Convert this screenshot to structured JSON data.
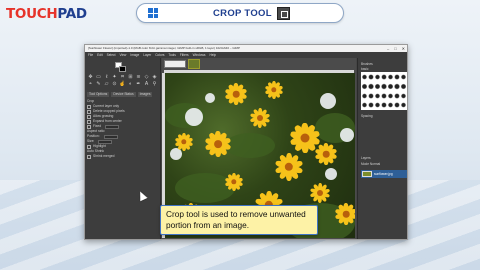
{
  "brand": {
    "part1": "TOUCH",
    "part2": "PAD"
  },
  "header": {
    "title": "CROP TOOL",
    "left_icon": "windows-icon",
    "right_icon": "crop-tool-icon"
  },
  "gimp": {
    "title": "[Sunflower Flower] (imported)-1.0 (RGB color 8-bit gamma integer, GIMP built-in sRGB, 1 layer) 1024x640 – GIMP",
    "menu": [
      "File",
      "Edit",
      "Select",
      "View",
      "Image",
      "Layer",
      "Colors",
      "Tools",
      "Filters",
      "Windows",
      "Help"
    ],
    "tool_options": {
      "tabs": [
        "Tool Options",
        "Device Status",
        "Images"
      ],
      "heading": "Crop",
      "current_layer_only": "Current layer only",
      "delete_pixels": "Delete cropped pixels",
      "allow_growing": "Allow growing",
      "expand_from_center": "Expand from center",
      "fixed": "Fixed",
      "aspect_ratio": "Aspect ratio",
      "highlight": "Highlight",
      "position": "Position:",
      "size": "Size:",
      "shrink": "Auto Shrink",
      "shrink_merged": "Shrink merged"
    },
    "dock": {
      "brushes_label": "Brushes",
      "brush_filter": "basic",
      "spacing_label": "Spacing",
      "layers_label": "Layers",
      "mode_label": "Mode Normal",
      "layer_name": "sunflower.jpg"
    },
    "photo_colors": {
      "petal": "#f6c21a",
      "center": "#b8600c",
      "foliage": "#2f4417"
    }
  },
  "caption": {
    "text": "Crop tool is used to remove unwanted portion from an image."
  },
  "colors": {
    "accent_red": "#e6332a",
    "accent_blue": "#1f3f8f",
    "caption_bg": "#fdf2a6",
    "caption_border": "#3f73c5"
  }
}
